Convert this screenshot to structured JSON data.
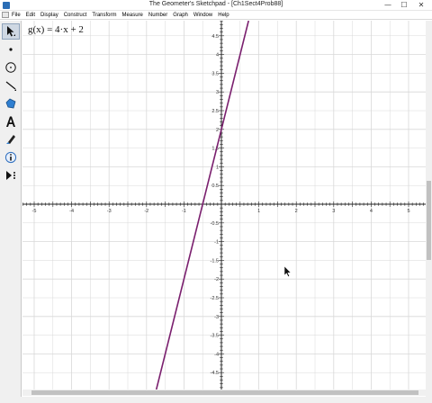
{
  "window": {
    "title": "The Geometer's Sketchpad - [Ch1Sect4Prob88]",
    "minimize_glyph": "—",
    "maximize_glyph": "☐",
    "close_glyph": "✕"
  },
  "menu": {
    "items": [
      "File",
      "Edit",
      "Display",
      "Construct",
      "Transform",
      "Measure",
      "Number",
      "Graph",
      "Window",
      "Help"
    ]
  },
  "toolbox": {
    "tools": [
      "arrow-select-icon",
      "point-icon",
      "compass-circle-icon",
      "straightedge-line-icon",
      "polygon-icon",
      "text-tool-icon",
      "marker-icon",
      "information-icon",
      "custom-tool-icon"
    ],
    "selected": "arrow-select-icon"
  },
  "sketch": {
    "function_label": "g(x) = 4·x + 2",
    "function_color": "#7a1f6e",
    "grid_color": "#d8d8d8",
    "axis_color": "#222222"
  },
  "chart_data": {
    "type": "line",
    "function": "g(x) = 4·x + 2",
    "slope": 4,
    "intercept": 2,
    "xlim": [
      -5.5,
      5.5
    ],
    "ylim": [
      -5,
      4.8
    ],
    "x_ticks": [
      -5,
      -4,
      -3,
      -2,
      -1,
      1,
      2,
      3,
      4,
      5
    ],
    "y_ticks": [
      -4.5,
      -4,
      -3.5,
      -3,
      -2.5,
      -2,
      -1.5,
      -1,
      -0.5,
      0.5,
      1,
      1.5,
      2,
      2.5,
      3,
      3.5,
      4,
      4.5
    ],
    "x_tick_labels": [
      "-5",
      "-4",
      "-3",
      "-2",
      "-1",
      "1",
      "2",
      "3",
      "4",
      "5"
    ],
    "y_tick_labels": [
      "-4.5",
      "-4",
      "-3.5",
      "-3",
      "-2.5",
      "-2",
      "-1.5",
      "-1",
      "-0.5",
      "0.5",
      "1",
      "1.5",
      "2",
      "2.5",
      "3",
      "3.5",
      "4",
      "4.5"
    ],
    "grid": true
  }
}
